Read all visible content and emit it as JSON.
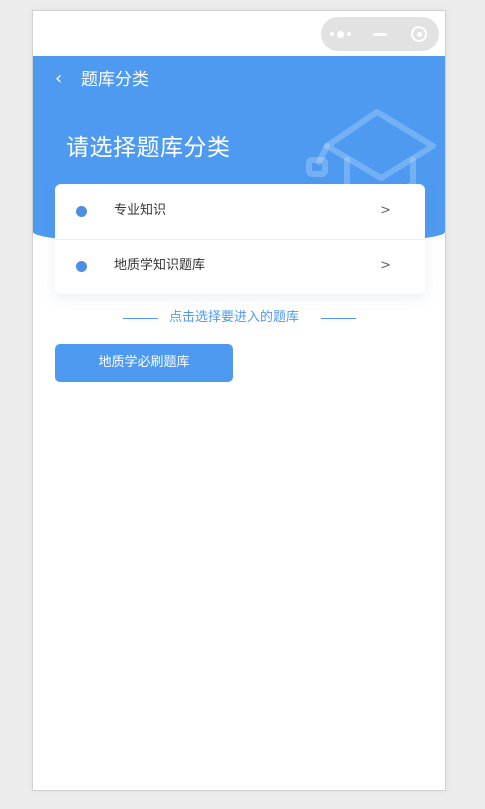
{
  "nav": {
    "back_icon": "chevron-left-icon",
    "title": "题库分类"
  },
  "hero": {
    "title": "请选择题库分类",
    "decoration_icon": "graduation-cap-icon"
  },
  "categories": [
    {
      "label": "专业知识",
      "arrow": ">"
    },
    {
      "label": "地质学知识题库",
      "arrow": ">"
    }
  ],
  "hint": {
    "text": "点击选择要进入的题库"
  },
  "action_button": {
    "label": "地质学必刷题库"
  },
  "colors": {
    "primary": "#4e9af1",
    "dot": "#4e8fe6",
    "background": "#ececec"
  },
  "capsule": {
    "more_icon": "more-dots-icon",
    "minimize_icon": "minimize-icon",
    "close_icon": "target-icon"
  }
}
